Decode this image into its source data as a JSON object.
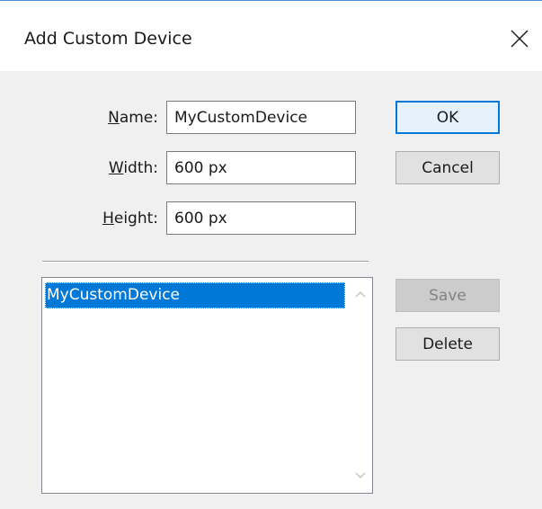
{
  "dialog": {
    "title": "Add Custom Device",
    "close_icon": "close-icon"
  },
  "fields": {
    "name": {
      "label_mnemonic": "N",
      "label_rest": "ame:",
      "value": "MyCustomDevice"
    },
    "width": {
      "label_mnemonic": "W",
      "label_rest": "idth:",
      "value": "600 px"
    },
    "height": {
      "label_mnemonic": "H",
      "label_rest": "eight:",
      "value": "600 px"
    }
  },
  "buttons": {
    "ok": "OK",
    "cancel": "Cancel",
    "save": "Save",
    "delete": "Delete"
  },
  "device_list": {
    "items": [
      "MyCustomDevice"
    ],
    "selected_index": 0,
    "scroll_up_icon": "chevron-up-icon",
    "scroll_down_icon": "chevron-down-icon"
  },
  "colors": {
    "accent": "#0078d7",
    "selection_bg": "#0078d7",
    "dialog_bg": "#f0f0f0",
    "titlebar_bg": "#ffffff"
  }
}
